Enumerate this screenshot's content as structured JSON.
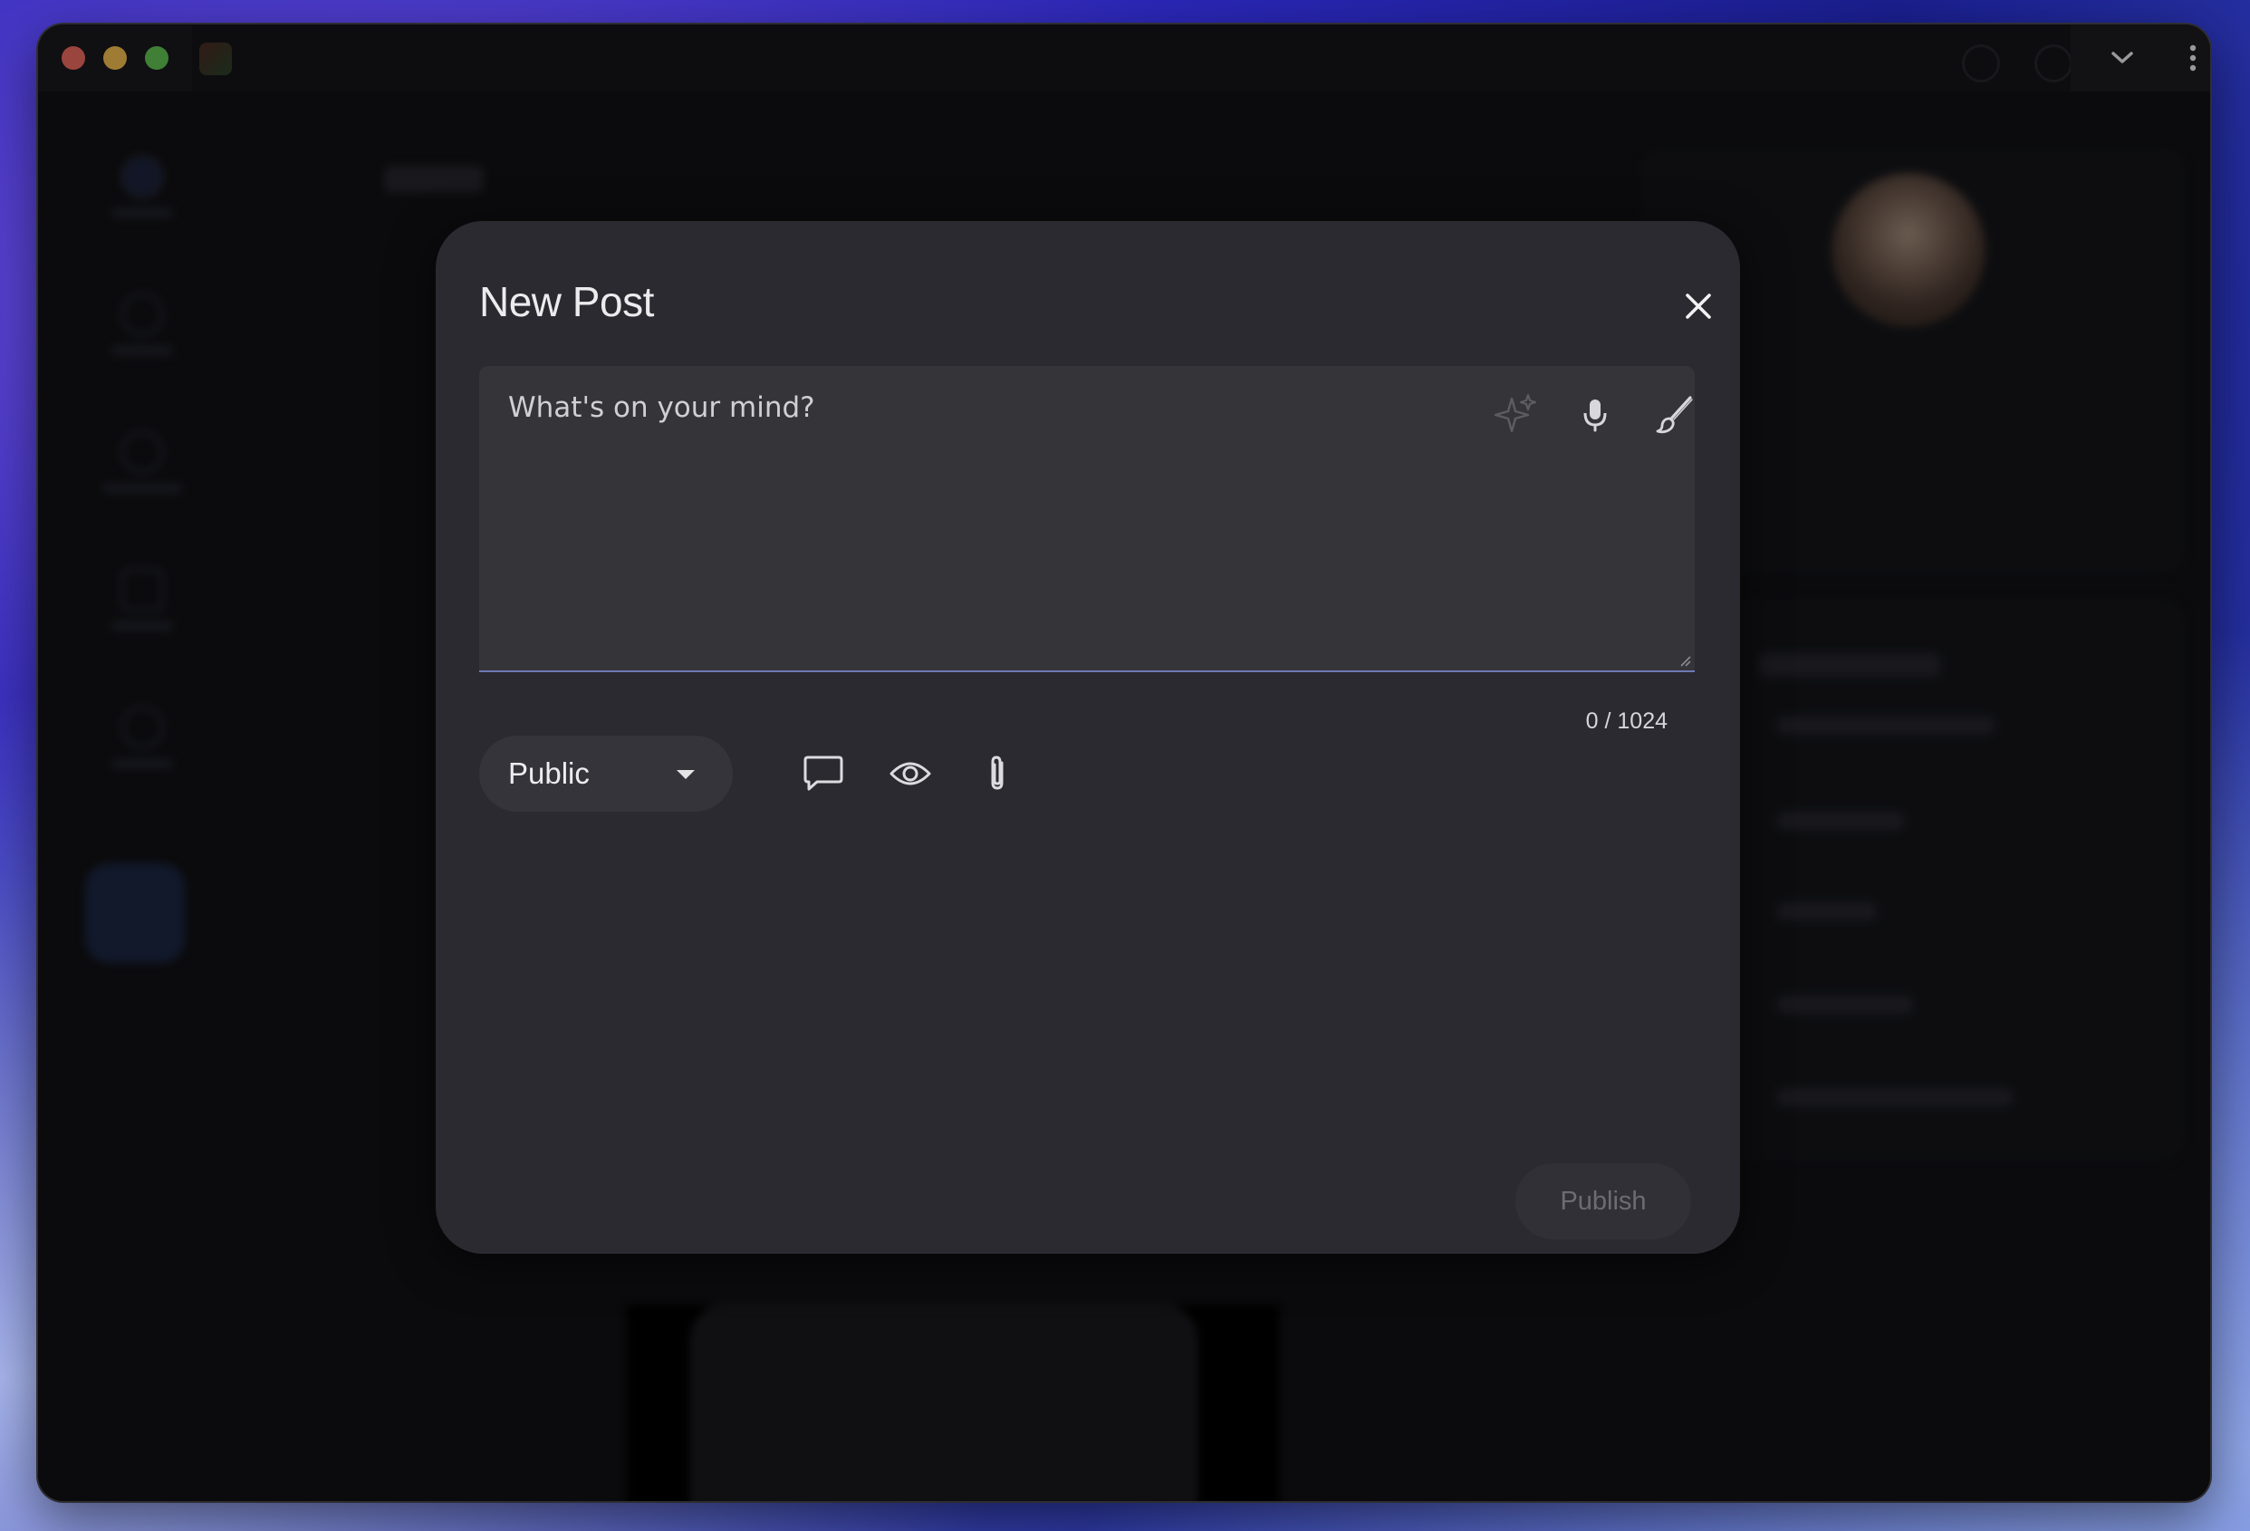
{
  "modal": {
    "title": "New Post",
    "textarea_placeholder": "What's on your mind?",
    "char_counter": "0 / 1024",
    "visibility": "Public",
    "publish_label": "Publish"
  },
  "icons": {
    "close": "close-icon",
    "ai_sparkle": "sparkle-icon",
    "mic": "microphone-icon",
    "brush": "brush-icon",
    "comment": "comment-icon",
    "eye": "eye-icon",
    "attach": "paperclip-icon",
    "dropdown": "chevron-down-icon",
    "menu": "more-vertical-icon"
  },
  "colors": {
    "modal_bg": "#2b2a30",
    "textarea_bg": "#353439",
    "focus_underline": "#6d7ab2",
    "publish_disabled_text": "#6c6c72"
  }
}
